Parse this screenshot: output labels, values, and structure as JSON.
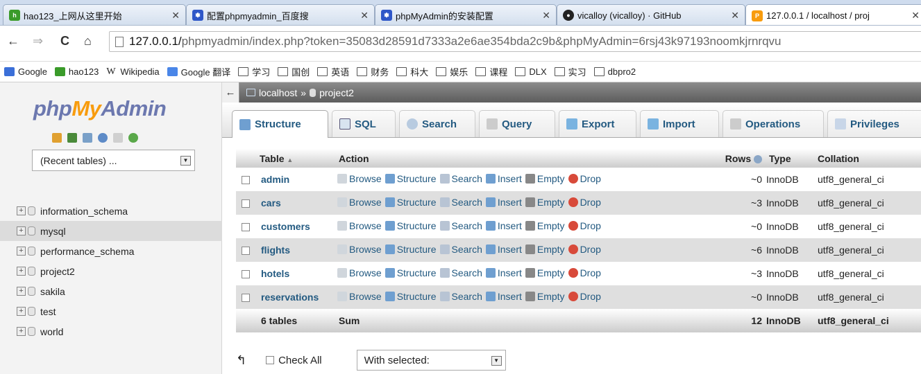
{
  "browser": {
    "tabs": [
      {
        "title": "hao123_上网从这里开始",
        "icon": "hao123-icon"
      },
      {
        "title": "配置phpmyadmin_百度搜",
        "icon": "baidu-icon"
      },
      {
        "title": "phpMyAdmin的安装配置",
        "icon": "baidu-icon"
      },
      {
        "title": "vicalloy (vicalloy) · GitHub",
        "icon": "github-icon"
      },
      {
        "title": "127.0.0.1 / localhost / proj",
        "icon": "pma-icon"
      }
    ],
    "url_host": "127.0.0.1/",
    "url_rest": "phpmyadmin/index.php?token=35083d28591d7333a2e6ae354bda2c9b&phpMyAdmin=6rsj43k97193noomkjrnrqvu",
    "bookmarks": [
      "Google",
      "hao123",
      "Wikipedia",
      "Google 翻译",
      "学习",
      "国创",
      "英语",
      "财务",
      "科大",
      "娱乐",
      "课程",
      "DLX",
      "实习",
      "dbpro2"
    ]
  },
  "sidebar": {
    "logo_php": "php",
    "logo_my": "My",
    "logo_admin": "Admin",
    "recent_label": "(Recent tables) ...",
    "databases": [
      "information_schema",
      "mysql",
      "performance_schema",
      "project2",
      "sakila",
      "test",
      "world"
    ]
  },
  "breadcrumb": {
    "server": "localhost",
    "sep": "»",
    "db": "project2"
  },
  "tabs": [
    "Structure",
    "SQL",
    "Search",
    "Query",
    "Export",
    "Import",
    "Operations",
    "Privileges"
  ],
  "table": {
    "headers": {
      "table": "Table",
      "action": "Action",
      "rows": "Rows",
      "type": "Type",
      "collation": "Collation"
    },
    "actions": [
      "Browse",
      "Structure",
      "Search",
      "Insert",
      "Empty",
      "Drop"
    ],
    "rows": [
      {
        "name": "admin",
        "rows": "~0",
        "type": "InnoDB",
        "collation": "utf8_general_ci"
      },
      {
        "name": "cars",
        "rows": "~3",
        "type": "InnoDB",
        "collation": "utf8_general_ci"
      },
      {
        "name": "customers",
        "rows": "~0",
        "type": "InnoDB",
        "collation": "utf8_general_ci"
      },
      {
        "name": "flights",
        "rows": "~6",
        "type": "InnoDB",
        "collation": "utf8_general_ci"
      },
      {
        "name": "hotels",
        "rows": "~3",
        "type": "InnoDB",
        "collation": "utf8_general_ci"
      },
      {
        "name": "reservations",
        "rows": "~0",
        "type": "InnoDB",
        "collation": "utf8_general_ci"
      }
    ],
    "footer": {
      "count": "6 tables",
      "label": "Sum",
      "rows": "12",
      "type": "InnoDB",
      "collation": "utf8_general_ci"
    }
  },
  "bottom": {
    "check_all": "Check All",
    "with_selected": "With selected:"
  },
  "colors": {
    "link": "#235a81",
    "logo_blue": "#6c78af",
    "logo_orange": "#f89c0e"
  }
}
